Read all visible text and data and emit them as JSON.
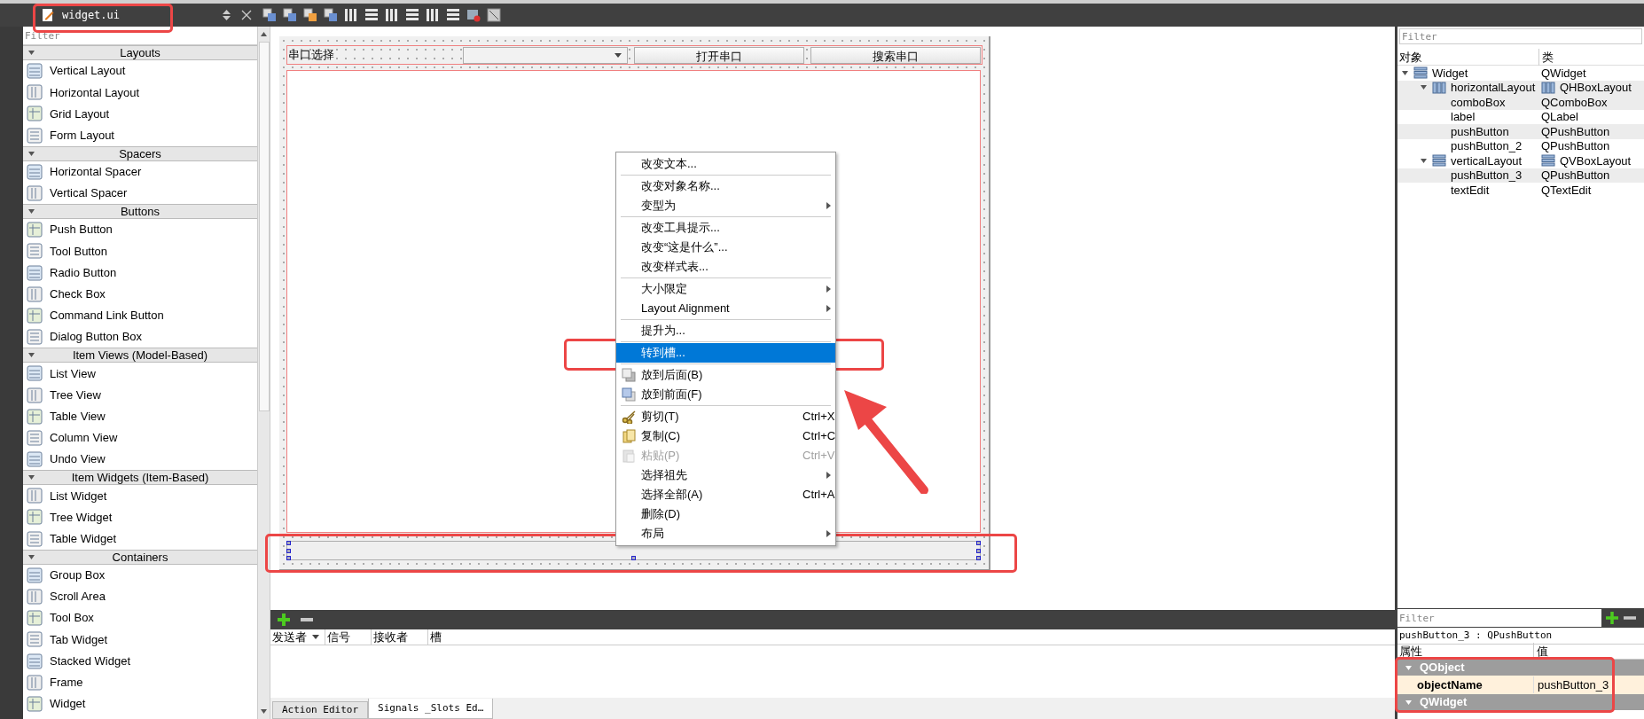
{
  "editor_tab": {
    "filename": "widget.ui"
  },
  "widget_box": {
    "filter_placeholder": "Filter",
    "categories": [
      {
        "title": "Layouts",
        "expanded": true,
        "items": [
          "Vertical Layout",
          "Horizontal Layout",
          "Grid Layout",
          "Form Layout"
        ]
      },
      {
        "title": "Spacers",
        "expanded": true,
        "items": [
          "Horizontal Spacer",
          "Vertical Spacer"
        ]
      },
      {
        "title": "Buttons",
        "expanded": true,
        "items": [
          "Push Button",
          "Tool Button",
          "Radio Button",
          "Check Box",
          "Command Link Button",
          "Dialog Button Box"
        ]
      },
      {
        "title": "Item Views (Model-Based)",
        "expanded": true,
        "items": [
          "List View",
          "Tree View",
          "Table View",
          "Column View",
          "Undo View"
        ]
      },
      {
        "title": "Item Widgets (Item-Based)",
        "expanded": true,
        "items": [
          "List Widget",
          "Tree Widget",
          "Table Widget"
        ]
      },
      {
        "title": "Containers",
        "expanded": true,
        "items": [
          "Group Box",
          "Scroll Area",
          "Tool Box",
          "Tab Widget",
          "Stacked Widget",
          "Frame",
          "Widget"
        ]
      }
    ]
  },
  "form": {
    "label": "串口选择",
    "buttons": [
      "打开串口",
      "搜索串口"
    ]
  },
  "context_menu": [
    {
      "kind": "item",
      "label": "改变文本...",
      "submenu": false,
      "disabled": false,
      "selected": false
    },
    {
      "kind": "separator"
    },
    {
      "kind": "item",
      "label": "改变对象名称...",
      "submenu": false,
      "disabled": false,
      "selected": false
    },
    {
      "kind": "item",
      "label": "变型为",
      "submenu": true,
      "disabled": false,
      "selected": false
    },
    {
      "kind": "separator"
    },
    {
      "kind": "item",
      "label": "改变工具提示...",
      "submenu": false,
      "disabled": false,
      "selected": false
    },
    {
      "kind": "item",
      "label": "改变“这是什么”...",
      "submenu": false,
      "disabled": false,
      "selected": false
    },
    {
      "kind": "item",
      "label": "改变样式表...",
      "submenu": false,
      "disabled": false,
      "selected": false
    },
    {
      "kind": "separator"
    },
    {
      "kind": "item",
      "label": "大小限定",
      "submenu": true,
      "disabled": false,
      "selected": false
    },
    {
      "kind": "item",
      "label": "Layout Alignment",
      "submenu": true,
      "disabled": false,
      "selected": false
    },
    {
      "kind": "separator"
    },
    {
      "kind": "item",
      "label": "提升为...",
      "submenu": false,
      "disabled": false,
      "selected": false
    },
    {
      "kind": "separator"
    },
    {
      "kind": "item",
      "label": "转到槽...",
      "submenu": false,
      "disabled": false,
      "selected": true
    },
    {
      "kind": "separator"
    },
    {
      "kind": "item",
      "label": "放到后面(B)",
      "submenu": false,
      "disabled": false,
      "selected": false
    },
    {
      "kind": "item",
      "label": "放到前面(F)",
      "submenu": false,
      "disabled": false,
      "selected": false
    },
    {
      "kind": "separator"
    },
    {
      "kind": "item",
      "label": "剪切(T)",
      "shortcut": "Ctrl+X",
      "submenu": false,
      "disabled": false,
      "selected": false
    },
    {
      "kind": "item",
      "label": "复制(C)",
      "shortcut": "Ctrl+C",
      "submenu": false,
      "disabled": false,
      "selected": false
    },
    {
      "kind": "item",
      "label": "粘贴(P)",
      "shortcut": "Ctrl+V",
      "submenu": false,
      "disabled": true,
      "selected": false
    },
    {
      "kind": "item",
      "label": "选择祖先",
      "submenu": true,
      "disabled": false,
      "selected": false
    },
    {
      "kind": "item",
      "label": "选择全部(A)",
      "shortcut": "Ctrl+A",
      "submenu": false,
      "disabled": false,
      "selected": false
    },
    {
      "kind": "item",
      "label": "删除(D)",
      "submenu": false,
      "disabled": false,
      "selected": false
    },
    {
      "kind": "item",
      "label": "布局",
      "submenu": true,
      "disabled": false,
      "selected": false
    }
  ],
  "signal_editor": {
    "columns": [
      "发送者",
      "信号",
      "接收者",
      "槽"
    ],
    "tabs": [
      {
        "label": "Action Editor",
        "selected": false
      },
      {
        "label": "Signals _Slots Ed…",
        "selected": true
      }
    ]
  },
  "object_inspector": {
    "filter_placeholder": "Filter",
    "columns": [
      "对象",
      "类"
    ],
    "tree": [
      {
        "name": "Widget",
        "class": "QWidget",
        "kind": "widget",
        "expanded": true,
        "children": [
          {
            "name": "horizontalLayout",
            "class": "QHBoxLayout",
            "kind": "hbox",
            "expanded": true,
            "children": [
              {
                "name": "comboBox",
                "class": "QComboBox"
              },
              {
                "name": "label",
                "class": "QLabel"
              },
              {
                "name": "pushButton",
                "class": "QPushButton"
              },
              {
                "name": "pushButton_2",
                "class": "QPushButton"
              }
            ]
          },
          {
            "name": "verticalLayout",
            "class": "QVBoxLayout",
            "kind": "vbox",
            "expanded": true,
            "children": [
              {
                "name": "pushButton_3",
                "class": "QPushButton"
              },
              {
                "name": "textEdit",
                "class": "QTextEdit"
              }
            ]
          }
        ]
      }
    ]
  },
  "property_editor": {
    "filter_placeholder": "Filter",
    "object_title": "pushButton_3 : QPushButton",
    "columns": [
      "属性",
      "值"
    ],
    "groups": [
      {
        "name": "QObject",
        "expanded": true,
        "properties": [
          {
            "name": "objectName",
            "value": "pushButton_3"
          }
        ]
      },
      {
        "name": "QWidget",
        "expanded": true
      }
    ]
  }
}
